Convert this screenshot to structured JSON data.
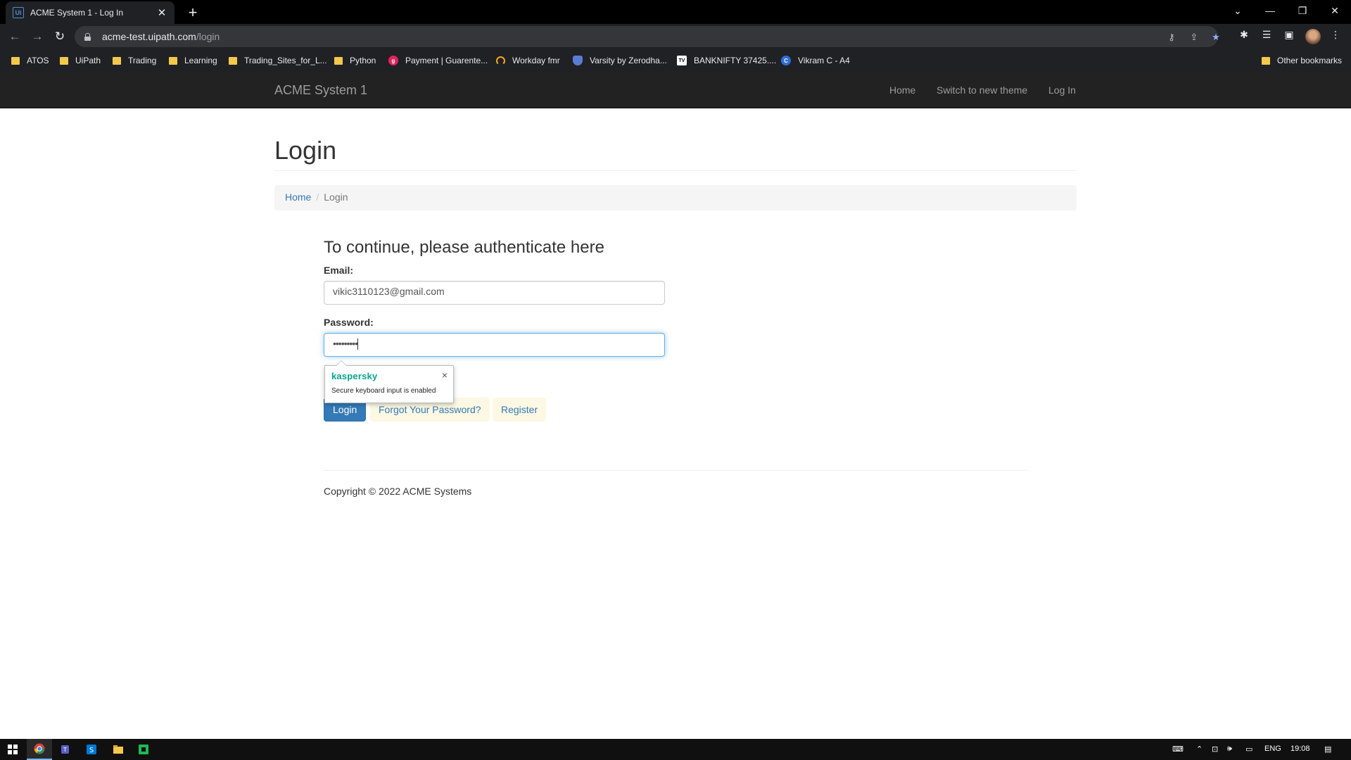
{
  "browser": {
    "tab_title": "ACME System 1 - Log In",
    "tab_favicon": "Ui",
    "url_host": "acme-test.uipath.com",
    "url_path": "/login",
    "bookmarks": [
      {
        "label": "ATOS",
        "icon": "folder-icon"
      },
      {
        "label": "UiPath",
        "icon": "folder-icon"
      },
      {
        "label": "Trading",
        "icon": "folder-icon"
      },
      {
        "label": "Learning",
        "icon": "folder-icon"
      },
      {
        "label": "Trading_Sites_for_L...",
        "icon": "folder-icon"
      },
      {
        "label": "Python",
        "icon": "folder-icon"
      },
      {
        "label": "Payment | Guarente...",
        "icon": "payment-icon",
        "glyph": "g"
      },
      {
        "label": "Workday fmr",
        "icon": "workday-icon"
      },
      {
        "label": "Varsity by Zerodha...",
        "icon": "varsity-icon"
      },
      {
        "label": "BANKNIFTY 37425....",
        "icon": "tradingview-icon",
        "glyph": "TV"
      },
      {
        "label": "Vikram C - A4",
        "icon": "c-icon",
        "glyph": "C"
      }
    ],
    "other_bookmarks": "Other bookmarks"
  },
  "site": {
    "brand": "ACME System 1",
    "nav": {
      "home": "Home",
      "theme": "Switch to new theme",
      "login": "Log In"
    }
  },
  "page": {
    "title": "Login",
    "breadcrumb": {
      "home": "Home",
      "separator": "/",
      "current": "Login"
    },
    "heading": "To continue, please authenticate here",
    "email_label": "Email:",
    "email_value": "vikic3110123@gmail.com",
    "password_label": "Password:",
    "password_masked": "•••••••••",
    "login_button": "Login",
    "forgot_link": "Forgot Your Password?",
    "register_link": "Register",
    "copyright": "Copyright © 2022 ACME Systems"
  },
  "kaspersky": {
    "brand": "kaspersky",
    "message": "Secure keyboard input is enabled",
    "close": "×"
  },
  "taskbar": {
    "lang": "ENG",
    "time": "19:08"
  },
  "colors": {
    "navbar": "#222222",
    "link": "#337ab7",
    "primary_button": "#337ab7",
    "kaspersky_green": "#00a88e"
  }
}
